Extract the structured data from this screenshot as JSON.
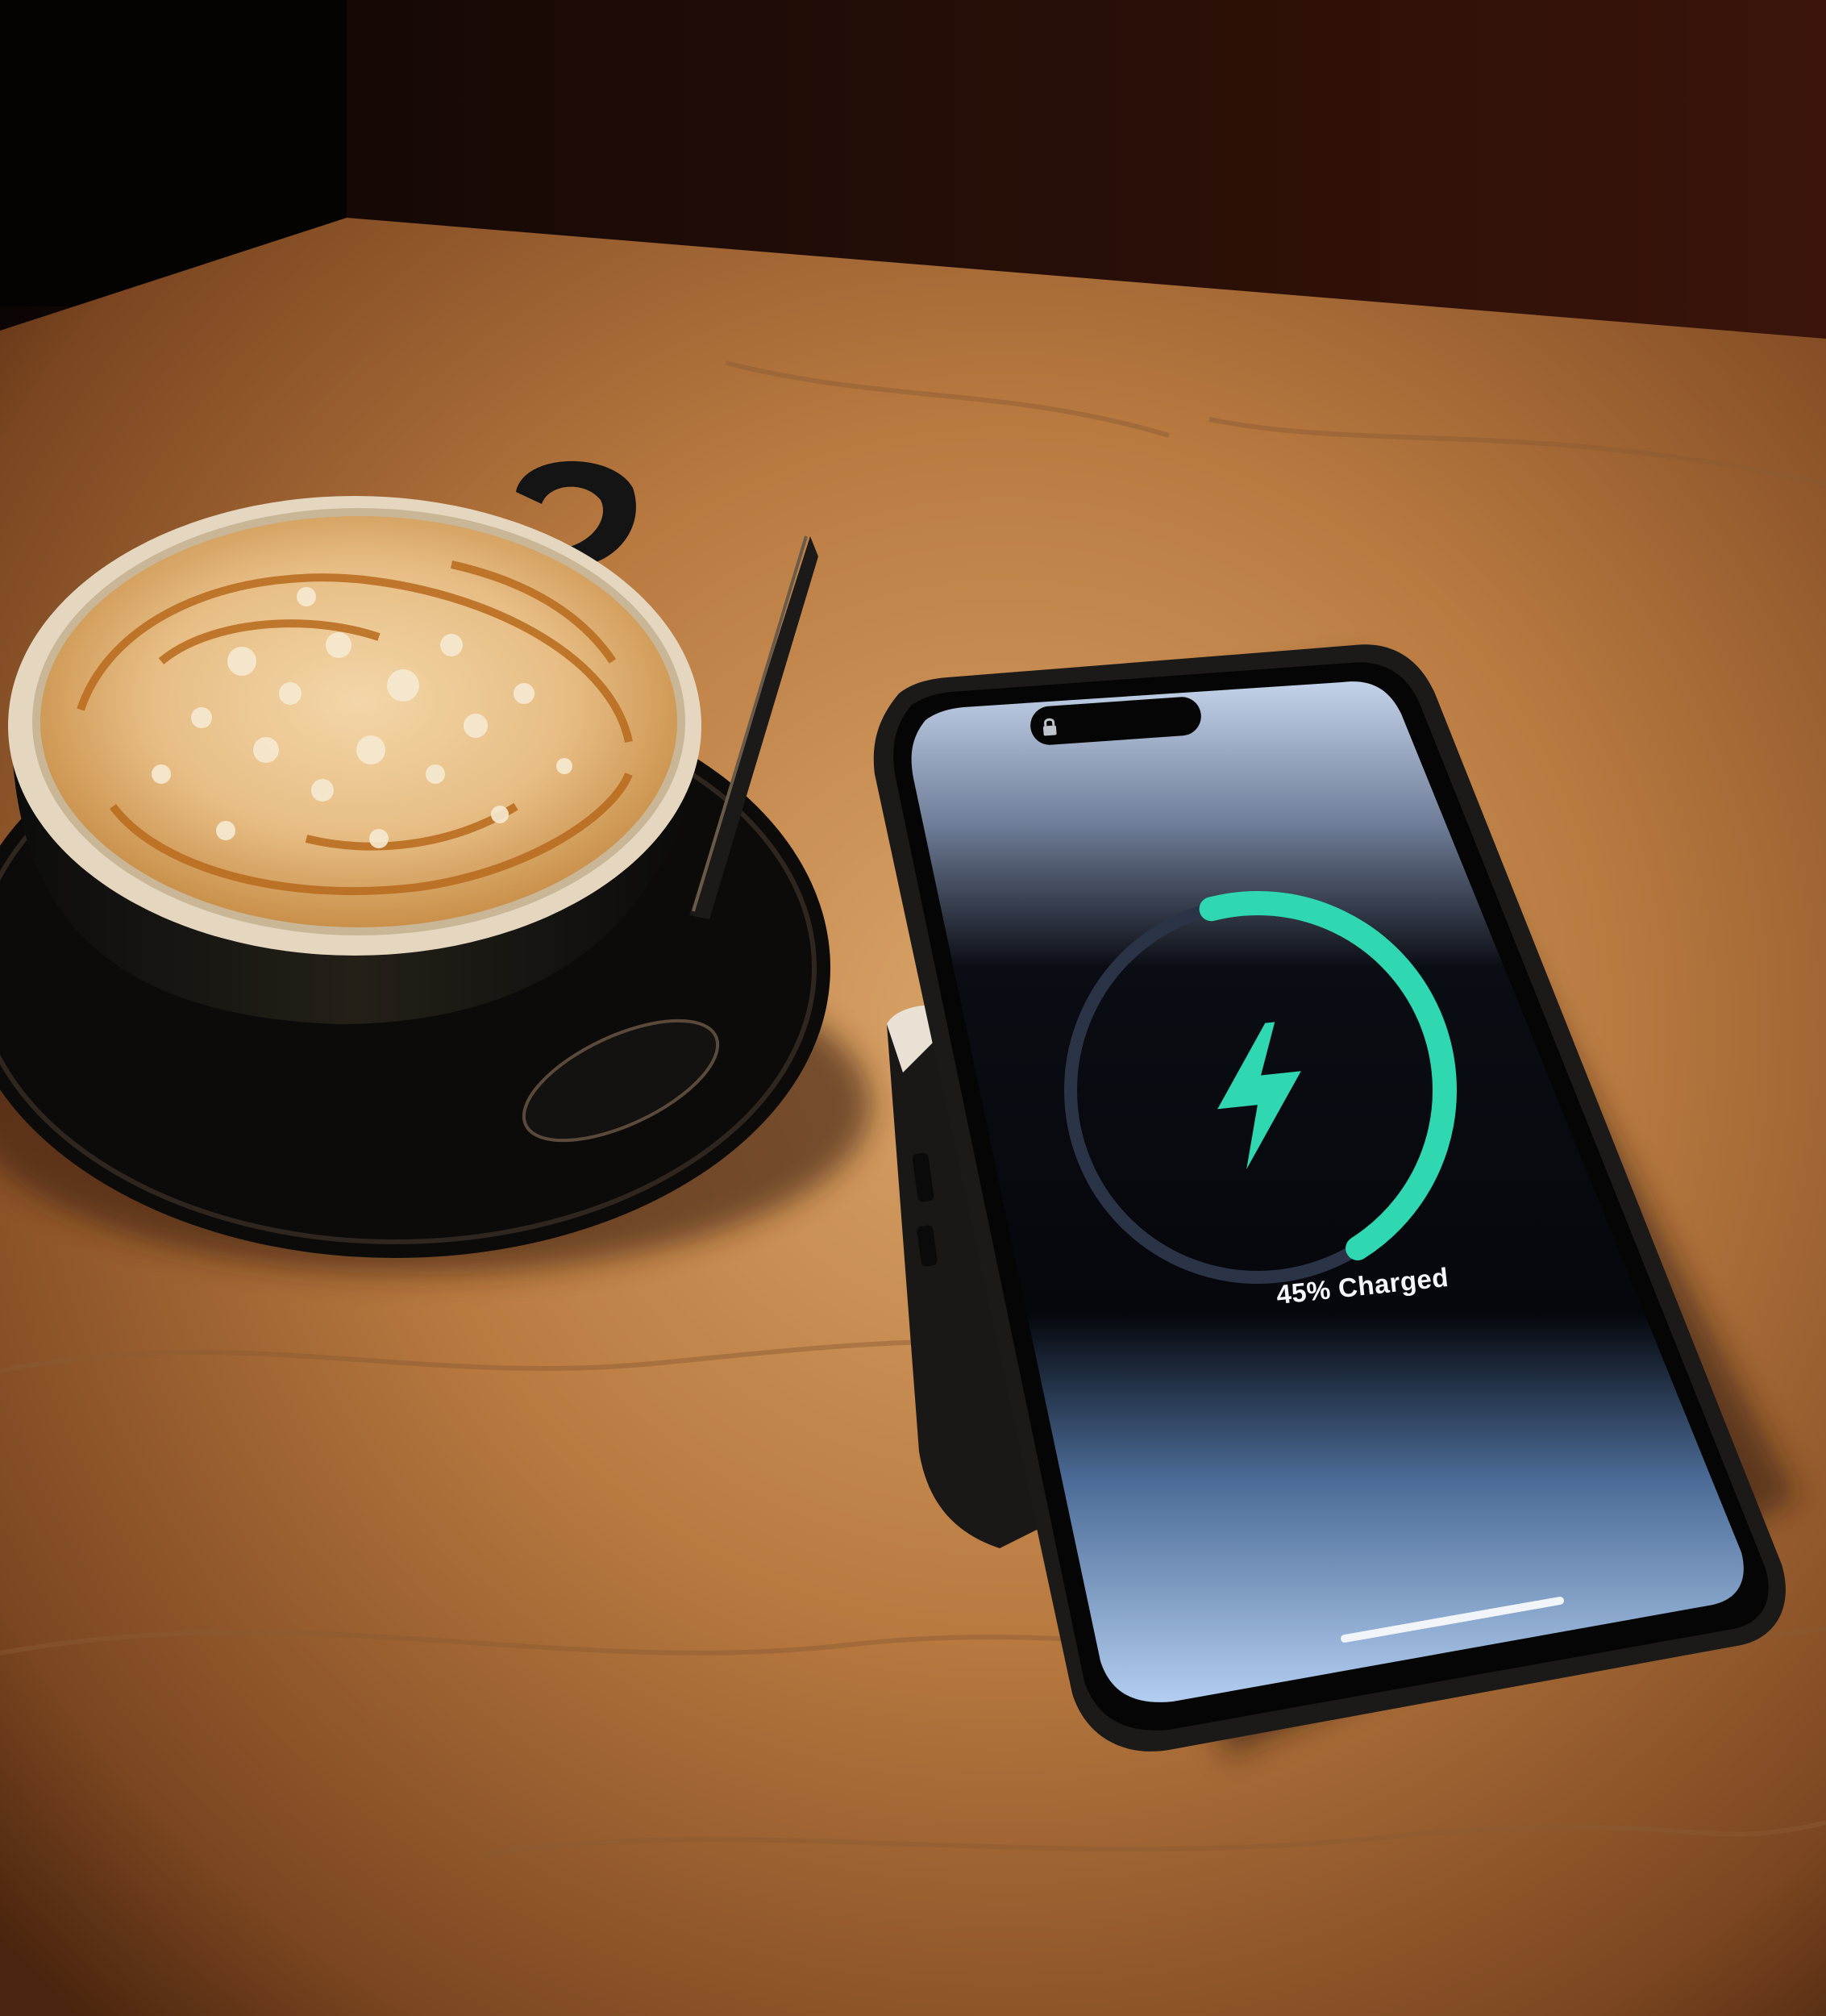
{
  "phone": {
    "charge_status": "45% Charged",
    "charge_level": 0.45,
    "ring_color": "#2fd8b0",
    "track_color": "#2b3446",
    "icon": "lightning-bolt-icon",
    "lock_icon": "lock-icon"
  },
  "colors": {
    "table_warm": "#c98a4e",
    "wall_dark": "#2a0f06",
    "cup": "#141414",
    "foam": "#e9c79a",
    "caramel": "#c47a25",
    "screen_top": "#c7d7ef",
    "screen_bottom": "#a9c7ec"
  }
}
